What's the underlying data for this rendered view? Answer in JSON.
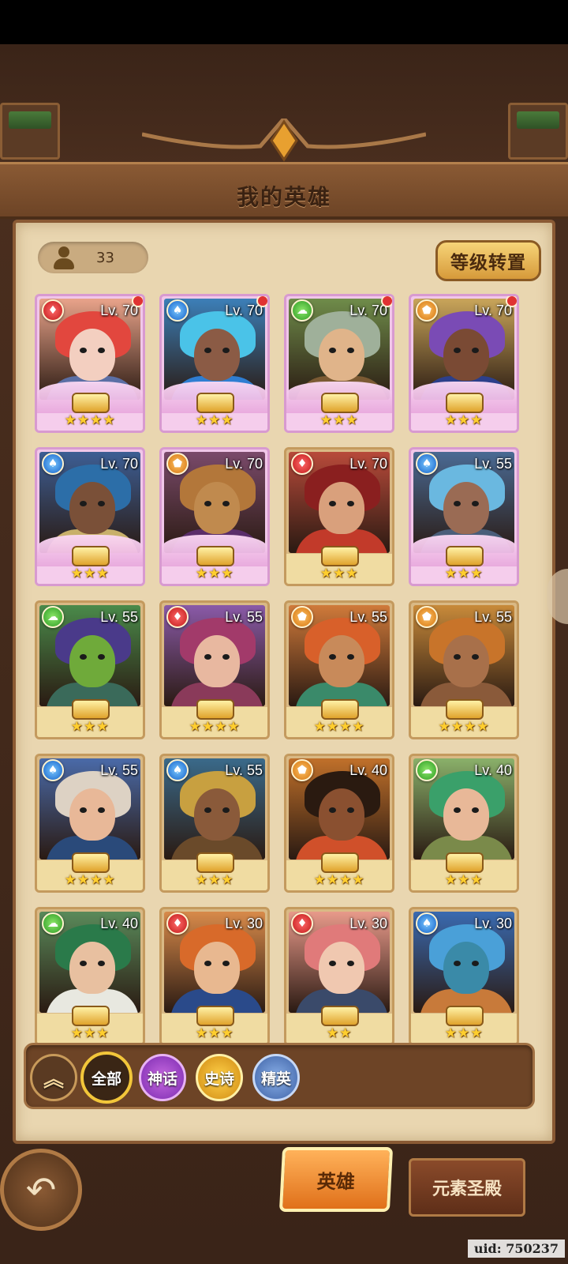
{
  "screen": {
    "title": "我的英雄",
    "hero_count": "33",
    "level_transfer": "等级转置"
  },
  "heroes": [
    {
      "level": "Lv. 70",
      "element": "fire",
      "stars": "★★★★",
      "myth": true,
      "dot": true,
      "hair": "#e2473e",
      "skin": "#f3cfc0",
      "outfit": "#5b6fa5",
      "bg": "#e9a38a"
    },
    {
      "level": "Lv. 70",
      "element": "water",
      "stars": "★★★",
      "myth": true,
      "dot": true,
      "hair": "#4ac3e8",
      "skin": "#8b5b45",
      "outfit": "#2f7ed2",
      "bg": "#3c7fb8"
    },
    {
      "level": "Lv. 70",
      "element": "wind",
      "stars": "★★★",
      "myth": true,
      "dot": true,
      "hair": "#9fb09a",
      "skin": "#e0b48a",
      "outfit": "#7b5a33",
      "bg": "#6f8c4a"
    },
    {
      "level": "Lv. 70",
      "element": "earth",
      "stars": "★★★",
      "myth": true,
      "dot": true,
      "hair": "#7a4bb5",
      "skin": "#7a4a34",
      "outfit": "#2c3f8a",
      "bg": "#c9a55a"
    },
    {
      "level": "Lv. 70",
      "element": "water",
      "stars": "★★★",
      "myth": true,
      "dot": false,
      "hair": "#2c6ea8",
      "skin": "#7a5038",
      "outfit": "#c8b06a",
      "bg": "#3d5e94"
    },
    {
      "level": "Lv. 70",
      "element": "earth",
      "stars": "★★★",
      "myth": true,
      "dot": false,
      "hair": "#b3773a",
      "skin": "#c08a4e",
      "outfit": "#5a2e6a",
      "bg": "#7a4a6a"
    },
    {
      "level": "Lv. 70",
      "element": "fire",
      "stars": "★★★",
      "myth": false,
      "dot": false,
      "hair": "#8a1f1f",
      "skin": "#d9a07c",
      "outfit": "#c23a2a",
      "bg": "#b84a3a"
    },
    {
      "level": "Lv. 55",
      "element": "water",
      "stars": "★★★",
      "myth": true,
      "dot": false,
      "hair": "#6ab8e0",
      "skin": "#9a6b54",
      "outfit": "#4a5e7a",
      "bg": "#4a6a94"
    },
    {
      "level": "Lv. 55",
      "element": "wind",
      "stars": "★★★",
      "myth": false,
      "dot": false,
      "hair": "#4a3a8a",
      "skin": "#6faa3a",
      "outfit": "#3a6a5a",
      "bg": "#4a8a4a"
    },
    {
      "level": "Lv. 55",
      "element": "fire",
      "stars": "★★★★",
      "myth": false,
      "dot": false,
      "hair": "#a23a6a",
      "skin": "#e8b8a0",
      "outfit": "#8a3a5a",
      "bg": "#8a5aa8"
    },
    {
      "level": "Lv. 55",
      "element": "earth",
      "stars": "★★★★",
      "myth": false,
      "dot": false,
      "hair": "#d8602a",
      "skin": "#c88a5a",
      "outfit": "#3a8a6a",
      "bg": "#d07a3a"
    },
    {
      "level": "Lv. 55",
      "element": "earth",
      "stars": "★★★★",
      "myth": false,
      "dot": false,
      "hair": "#c8742a",
      "skin": "#a8704a",
      "outfit": "#8a5a3a",
      "bg": "#c88a3a"
    },
    {
      "level": "Lv. 55",
      "element": "water",
      "stars": "★★★★",
      "myth": false,
      "dot": false,
      "hair": "#ddd2c4",
      "skin": "#e8b898",
      "outfit": "#2a4a7a",
      "bg": "#4a6aa8"
    },
    {
      "level": "Lv. 55",
      "element": "water",
      "stars": "★★★",
      "myth": false,
      "dot": false,
      "hair": "#c8a040",
      "skin": "#8a5a3a",
      "outfit": "#6a4a2a",
      "bg": "#3a6a8a"
    },
    {
      "level": "Lv. 40",
      "element": "earth",
      "stars": "★★★★",
      "myth": false,
      "dot": false,
      "hair": "#2a1a10",
      "skin": "#8a5030",
      "outfit": "#d0502a",
      "bg": "#c0702a"
    },
    {
      "level": "Lv. 40",
      "element": "wind",
      "stars": "★★★",
      "myth": false,
      "dot": false,
      "hair": "#3aa06a",
      "skin": "#e8b898",
      "outfit": "#7a8a4a",
      "bg": "#8ab06a"
    },
    {
      "level": "Lv. 40",
      "element": "wind",
      "stars": "★★★",
      "myth": false,
      "dot": false,
      "hair": "#2a7a4a",
      "skin": "#e8c0a0",
      "outfit": "#e8e8e0",
      "bg": "#5a8a5a"
    },
    {
      "level": "Lv. 30",
      "element": "fire",
      "stars": "★★★",
      "myth": false,
      "dot": false,
      "hair": "#d86a2a",
      "skin": "#e8b890",
      "outfit": "#2a4a8a",
      "bg": "#d88a4a"
    },
    {
      "level": "Lv. 30",
      "element": "fire",
      "stars": "★★",
      "myth": false,
      "dot": false,
      "hair": "#e07a7a",
      "skin": "#f0c8b0",
      "outfit": "#3a4a6a",
      "bg": "#e89a8a"
    },
    {
      "level": "Lv. 30",
      "element": "water",
      "stars": "★★★",
      "myth": false,
      "dot": false,
      "hair": "#4aa0d8",
      "skin": "#3a8aa8",
      "outfit": "#c87a3a",
      "bg": "#3a6ab0"
    }
  ],
  "filters": {
    "collapse": "︽",
    "all": "全部",
    "myth": "神话",
    "epic": "史诗",
    "elite": "精英"
  },
  "nav": {
    "back": "↶",
    "hero_tab": "英雄",
    "temple_tab": "元素圣殿"
  },
  "uid": "uid: 750237",
  "element_icons": {
    "fire": "♦",
    "water": "♠",
    "wind": "☁",
    "earth": "⬟"
  }
}
